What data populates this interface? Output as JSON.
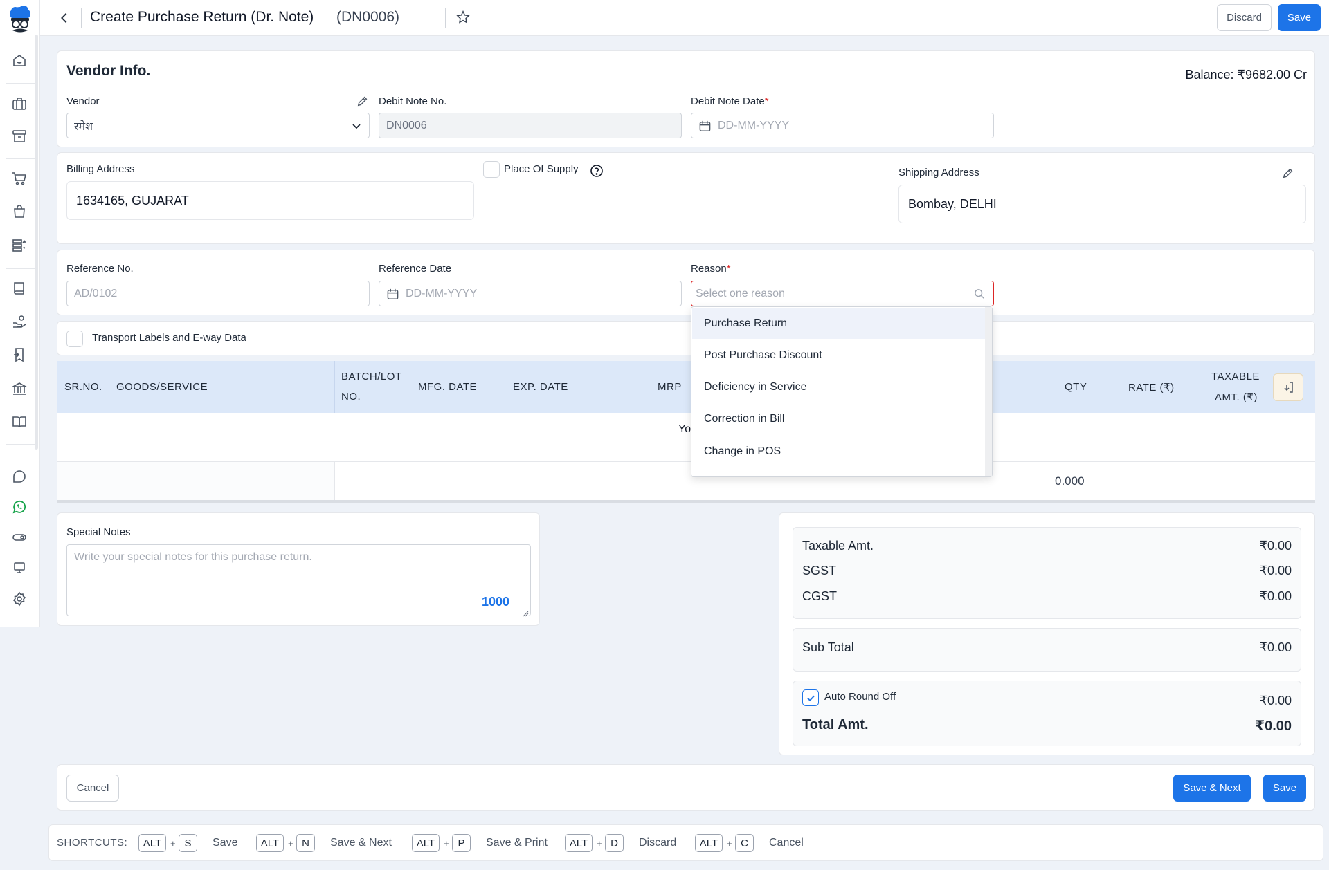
{
  "header": {
    "title": "Create Purchase Return (Dr. Note)",
    "doc_no": "(DN0006)",
    "discard_label": "Discard",
    "save_label": "Save"
  },
  "vendor_info": {
    "heading": "Vendor Info.",
    "balance": "Balance: ₹9682.00 Cr",
    "vendor_label": "Vendor",
    "vendor_value": "रमेश",
    "debit_note_no_label": "Debit Note No.",
    "debit_note_no_value": "DN0006",
    "debit_note_date_label": "Debit Note Date",
    "debit_note_date_placeholder": "DD-MM-YYYY",
    "required_mark": "*"
  },
  "address": {
    "billing_label": "Billing Address",
    "billing_value": "1634165, GUJARAT",
    "place_of_supply_label": "Place Of Supply",
    "shipping_label": "Shipping Address",
    "shipping_value": "Bombay, DELHI"
  },
  "reference": {
    "ref_no_label": "Reference No.",
    "ref_no_placeholder": "AD/0102",
    "ref_date_label": "Reference Date",
    "ref_date_placeholder": "DD-MM-YYYY",
    "reason_label": "Reason",
    "reason_placeholder": "Select one reason"
  },
  "transport": {
    "label": "Transport Labels and E-way Data"
  },
  "reason_options": [
    "Purchase Return",
    "Post Purchase Discount",
    "Deficiency in Service",
    "Correction in Bill",
    "Change in POS"
  ],
  "table": {
    "headers": {
      "sr_no": "SR.NO.",
      "goods": "GOODS/SERVICE",
      "batch_1": "BATCH/LOT",
      "batch_2": "NO.",
      "mfg": "MFG. DATE",
      "exp": "EXP. DATE",
      "mrp": "MRP",
      "qty": "QTY",
      "rate": "RATE (₹)",
      "taxable_1": "TAXABLE",
      "taxable_2": "AMT. (₹)"
    },
    "empty_text_fragment": "Yo",
    "qty_total": "0.000"
  },
  "notes": {
    "label": "Special Notes",
    "placeholder": "Write your special notes for this purchase return.",
    "char_count": "1000"
  },
  "summary": {
    "taxable_label": "Taxable Amt.",
    "taxable_value": "₹0.00",
    "sgst_label": "SGST",
    "sgst_value": "₹0.00",
    "cgst_label": "CGST",
    "cgst_value": "₹0.00",
    "subtotal_label": "Sub Total",
    "subtotal_value": "₹0.00",
    "round_off_label": "Auto Round Off",
    "round_off_value": "₹0.00",
    "total_label": "Total Amt.",
    "total_value": "₹0.00"
  },
  "footer": {
    "cancel_label": "Cancel",
    "save_next_label": "Save & Next",
    "save_label": "Save"
  },
  "shortcuts": {
    "title": "SHORTCUTS:",
    "plus": "+",
    "items": [
      {
        "mod": "ALT",
        "key": "S",
        "action": "Save"
      },
      {
        "mod": "ALT",
        "key": "N",
        "action": "Save & Next"
      },
      {
        "mod": "ALT",
        "key": "P",
        "action": "Save & Print"
      },
      {
        "mod": "ALT",
        "key": "D",
        "action": "Discard"
      },
      {
        "mod": "ALT",
        "key": "C",
        "action": "Cancel"
      }
    ]
  },
  "colors": {
    "primary": "#1d74e8",
    "table_header": "#dce8f9",
    "required": "#dc2626",
    "whatsapp": "#16a34a"
  },
  "sidebar_icons": [
    "home-icon",
    "briefcase-icon",
    "archive-icon",
    "cart-icon",
    "bag-icon",
    "stock-icon",
    "book-icon",
    "hand-coins-icon",
    "receipt-icon",
    "bank-icon",
    "open-book-icon",
    "chat-icon",
    "whatsapp-icon",
    "toggle-icon",
    "monitor-icon",
    "settings-icon"
  ]
}
